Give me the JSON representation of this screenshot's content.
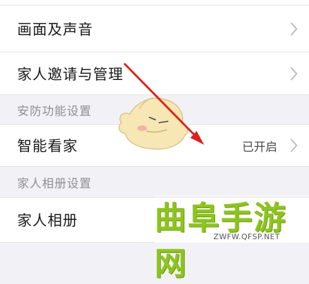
{
  "settings": {
    "rows": [
      {
        "label": "画面及声音",
        "value": ""
      },
      {
        "label": "家人邀请与管理",
        "value": ""
      },
      {
        "label": "智能看家",
        "value": "已开启"
      },
      {
        "label": "家人相册",
        "value": ""
      }
    ],
    "sections": [
      {
        "title": "安防功能设置"
      },
      {
        "title": "家人相册设置"
      }
    ]
  },
  "icons": {
    "row_chevron": "chevron-right-icon",
    "annotation": "red-arrow-icon",
    "mascot": "mascot-icon"
  },
  "watermark": {
    "title": "曲阜手游网",
    "url": "ZWFW.QFSP.NET"
  },
  "colors": {
    "background": "#f2f2f6",
    "row_background": "#ffffff",
    "section_text": "#8e8e93",
    "arrow": "#d9231e",
    "watermark_green": "#8fc31f"
  }
}
